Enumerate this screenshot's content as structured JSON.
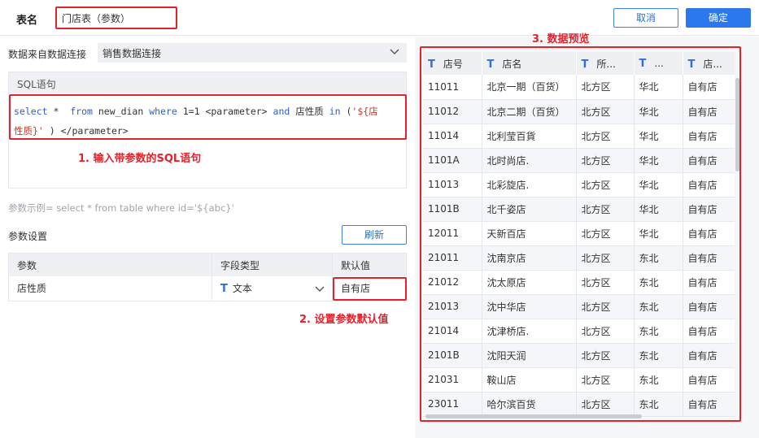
{
  "header": {
    "table_name_label": "表名",
    "table_name_value": "门店表（参数）",
    "cancel_label": "取消",
    "confirm_label": "确定"
  },
  "source": {
    "label": "数据来自数据连接",
    "selected": "销售数据连接"
  },
  "sql": {
    "header": "SQL语句",
    "line1_kw1": "select",
    "line1_t1": " *  ",
    "line1_kw2": "from",
    "line1_t2": " new_dian ",
    "line1_kw3": "where",
    "line1_t3": " 1=1 <parameter> ",
    "line1_kw4": "and",
    "line1_t4": " 店性质 ",
    "line1_kw5": "in",
    "line1_t5": " (",
    "line1_str": "'${店",
    "line2_str": "性质}'",
    "line2_t": " ) </parameter>"
  },
  "param_example": "参数示例= select * from table where id='${abc}'",
  "params": {
    "title": "参数设置",
    "refresh_label": "刷新",
    "columns": [
      "参数",
      "字段类型",
      "默认值"
    ],
    "row": {
      "name": "店性质",
      "type_icon": "T",
      "type": "文本",
      "default": "自有店"
    }
  },
  "annotations": {
    "a1": "1. 输入带参数的SQL语句",
    "a2": "2. 设置参数默认值",
    "a3": "3. 数据预览"
  },
  "preview": {
    "columns": [
      "店号",
      "店名",
      "所...",
      "...",
      "店..."
    ],
    "rows": [
      [
        "11011",
        "北京一期（百货）",
        "北方区",
        "华北",
        "自有店"
      ],
      [
        "11012",
        "北京二期（百货）",
        "北方区",
        "华北",
        "自有店"
      ],
      [
        "11014",
        "北利莹百貨",
        "北方区",
        "华北",
        "自有店"
      ],
      [
        "1101A",
        "北时尚店.",
        "北方区",
        "华北",
        "自有店"
      ],
      [
        "11013",
        "北彩旋店.",
        "北方区",
        "华北",
        "自有店"
      ],
      [
        "1101B",
        "北千姿店",
        "北方区",
        "华北",
        "自有店"
      ],
      [
        "12011",
        "天新百店",
        "北方区",
        "华北",
        "自有店"
      ],
      [
        "21011",
        "沈南京店",
        "北方区",
        "东北",
        "自有店"
      ],
      [
        "21012",
        "沈太原店",
        "北方区",
        "东北",
        "自有店"
      ],
      [
        "21013",
        "沈中华店",
        "北方区",
        "东北",
        "自有店"
      ],
      [
        "21014",
        "沈津桥店.",
        "北方区",
        "东北",
        "自有店"
      ],
      [
        "2101B",
        "沈阳天润",
        "北方区",
        "东北",
        "自有店"
      ],
      [
        "21031",
        "鞍山店",
        "北方区",
        "东北",
        "自有店"
      ],
      [
        "23011",
        "哈尔滨百货",
        "北方区",
        "东北",
        "自有店"
      ]
    ]
  }
}
